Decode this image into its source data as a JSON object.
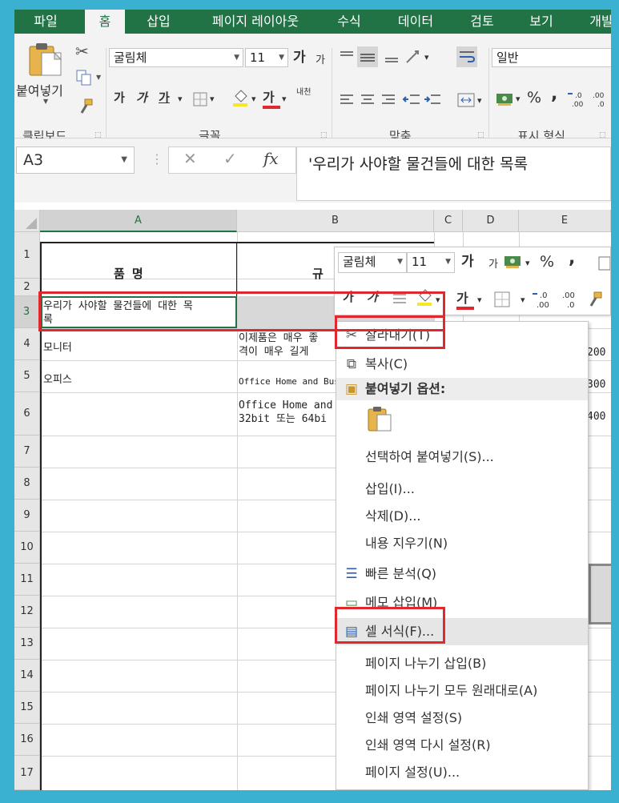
{
  "ribbon": {
    "tabs": [
      "파일",
      "홈",
      "삽입",
      "페이지 레이아웃",
      "수식",
      "데이터",
      "검토",
      "보기",
      "개발"
    ],
    "paste_label": "붙여넣기",
    "font_name": "굴림체",
    "font_size": "11",
    "number_format": "일반",
    "group_clipboard": "클립보드",
    "group_font": "글꼴",
    "group_alignment": "맞춤",
    "group_number": "표시 형식",
    "bold": "가",
    "italic": "가",
    "underline": "가",
    "grow_font": "가",
    "shrink_font": "가",
    "font_color": "가",
    "phonetic": "내천",
    "percent": "%",
    "comma": ","
  },
  "formula_bar": {
    "name_box": "A3",
    "fx": "fx",
    "content": "'우리가 사야할 물건들에 대한 목록"
  },
  "grid": {
    "columns": [
      "A",
      "B",
      "C",
      "D",
      "E"
    ],
    "rows": [
      "1",
      "2",
      "3",
      "4",
      "5",
      "6",
      "7",
      "8",
      "9",
      "10",
      "11",
      "12",
      "13",
      "14",
      "15",
      "16",
      "17"
    ],
    "a1": "품    명",
    "b1": "규",
    "a3_line1": "우리가 사야할 물건들에 대한 목",
    "a3_line2": "록",
    "a4": "모니터",
    "b4_line1": "이제품은 매우 좋",
    "b4_line2": "격이 매우 길게",
    "a5": "오피스",
    "b5": "Office Home and Bus",
    "b6_line1": "Office Home and",
    "b6_line2": "32bit 또는 64bi",
    "e4": "200",
    "e5": "300",
    "e6": "400"
  },
  "mini_toolbar": {
    "font_name": "굴림체",
    "font_size": "11",
    "grow": "가",
    "shrink": "가",
    "percent": "%",
    "comma": ",",
    "bold": "가",
    "italic": "가",
    "font_color": "가"
  },
  "context_menu": {
    "cut": "잘라내기(T)",
    "copy": "복사(C)",
    "paste_options": "붙여넣기 옵션:",
    "paste_special": "선택하여 붙여넣기(S)...",
    "insert": "삽입(I)...",
    "delete": "삭제(D)...",
    "clear_contents": "내용 지우기(N)",
    "quick_analysis": "빠른 분석(Q)",
    "insert_comment": "메모 삽입(M)",
    "format_cells": "셀 서식(F)...",
    "insert_page_break": "페이지 나누기 삽입(B)",
    "reset_page_breaks": "페이지 나누기 모두 원래대로(A)",
    "set_print_area": "인쇄 영역 설정(S)",
    "reset_print_area": "인쇄 영역 다시 설정(R)",
    "page_setup": "페이지 설정(U)..."
  },
  "colors": {
    "excel_green": "#217346",
    "highlight_red": "#e0282f",
    "frame_blue": "#3ab1d0"
  }
}
